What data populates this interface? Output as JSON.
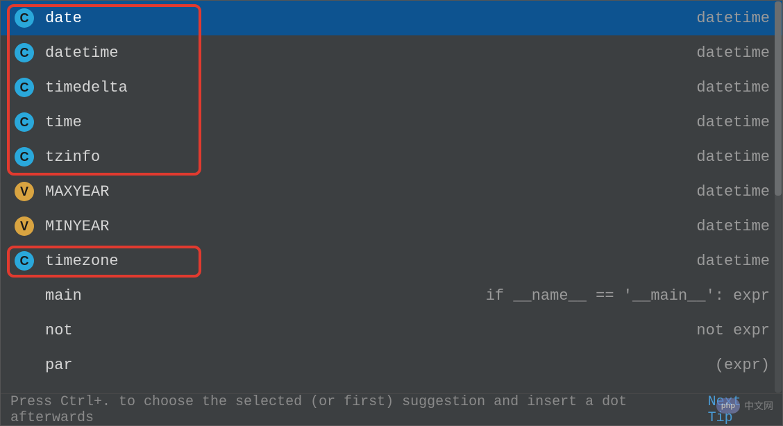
{
  "items": [
    {
      "icon": "class",
      "label": "date",
      "right": "datetime",
      "selected": true
    },
    {
      "icon": "class",
      "label": "datetime",
      "right": "datetime",
      "selected": false
    },
    {
      "icon": "class",
      "label": "timedelta",
      "right": "datetime",
      "selected": false
    },
    {
      "icon": "class",
      "label": "time",
      "right": "datetime",
      "selected": false
    },
    {
      "icon": "class",
      "label": "tzinfo",
      "right": "datetime",
      "selected": false
    },
    {
      "icon": "variable",
      "label": "MAXYEAR",
      "right": "datetime",
      "selected": false
    },
    {
      "icon": "variable",
      "label": "MINYEAR",
      "right": "datetime",
      "selected": false
    },
    {
      "icon": "class",
      "label": "timezone",
      "right": "datetime",
      "selected": false
    },
    {
      "icon": "",
      "label": "main",
      "right": "if __name__ == '__main__': expr",
      "selected": false
    },
    {
      "icon": "",
      "label": "not",
      "right": "not expr",
      "selected": false
    },
    {
      "icon": "",
      "label": "par",
      "right": "(expr)",
      "selected": false
    }
  ],
  "icon_glyphs": {
    "class": "c",
    "variable": "v"
  },
  "status": {
    "text": "Press Ctrl+. to choose the selected (or first) suggestion and insert a dot afterwards",
    "next_tip": "Next Tip"
  },
  "watermark": {
    "logo": "php",
    "text": "中文网"
  }
}
